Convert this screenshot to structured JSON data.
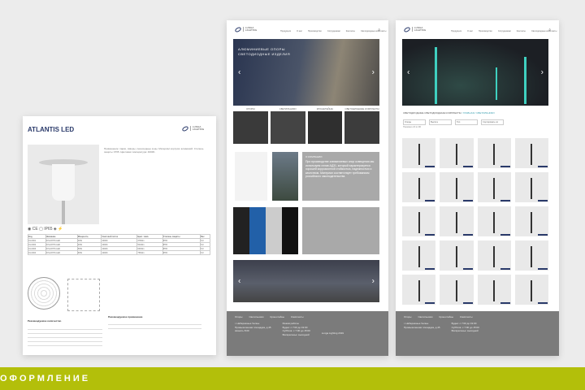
{
  "datasheet": {
    "title": "ATLANTIS LED",
    "logo": "LUNGA LIGHTING",
    "description": "Применение: парки, скверы, пешеходные зоны. Материал корпуса: алюминий. Степень защиты: IP65. Цветовая температура: 4000K.",
    "table_headers": [
      "Код",
      "Название",
      "Мощность",
      "Световой поток",
      "Цвет. темп.",
      "Степень защиты",
      "Вес"
    ],
    "table_rows": [
      [
        "01-0001",
        "ATLANTIS LED",
        "30W",
        "4000K",
        "3780lm",
        "IP65",
        "5,9"
      ],
      [
        "01-0002",
        "ATLANTIS LED",
        "40W",
        "4000K",
        "5040lm",
        "IP65",
        "5,9"
      ],
      [
        "01-0003",
        "ATLANTIS LED",
        "50W",
        "4000K",
        "6300lm",
        "IP65",
        "5,9"
      ],
      [
        "01-0004",
        "ATLANTIS LED",
        "60W",
        "4000K",
        "7560lm",
        "IP65",
        "5,9"
      ]
    ],
    "bottom_left_title": "Рекомендуемое количество",
    "bottom_right_title": "Рекомендуемое применение"
  },
  "site": {
    "logo": "LUNGA LIGHTING",
    "nav": [
      "Продукция",
      "О нас",
      "Производство",
      "Сотрудникам",
      "Контакты",
      "Светодиодные комплекты"
    ],
    "hero_title": "Алюминиевые опоры светодиодные изделия",
    "categories": [
      "Опоры",
      "Светильники",
      "Кронштейны",
      "Светодиодные комплекты"
    ],
    "info_heading": "О компании",
    "info_text": "При производстве алюминиевых опор освещения мы используем сплав АД31, который характеризуется хорошей коррозионной стойкостью, надежностью и качеством. Материал соответствует требованиям российского законодательства.",
    "footer_links": [
      "Опоры",
      "Светильники",
      "Кронштейны",
      "Комплекты"
    ],
    "footer_address": [
      "г. Набережные Челны",
      "Промышленная площадка, д.45",
      "звонить 8:00"
    ],
    "footer_hours_title": "Режим работы",
    "footer_hours": [
      "Будни: с 7:00 до 19:00",
      "Суббота: с 7:00 до 15:00",
      "Воскресенье: выходной"
    ],
    "footer_copy": "Lunga Lighting 2019"
  },
  "catalog": {
    "heading": "Светодиодные светодиодные комплекты",
    "breadcrumb": "/ Главная / Светильники",
    "filters": [
      "Опоры",
      "Высота",
      "Тип",
      "Сортировать по"
    ],
    "count_text": "Показано 24 из 96"
  },
  "section_label": "ОФОРМЛЕНИЕ",
  "colors": {
    "accent": "#b3bf0a",
    "brand": "#2a3a6a",
    "footer": "#7b7b7b"
  }
}
